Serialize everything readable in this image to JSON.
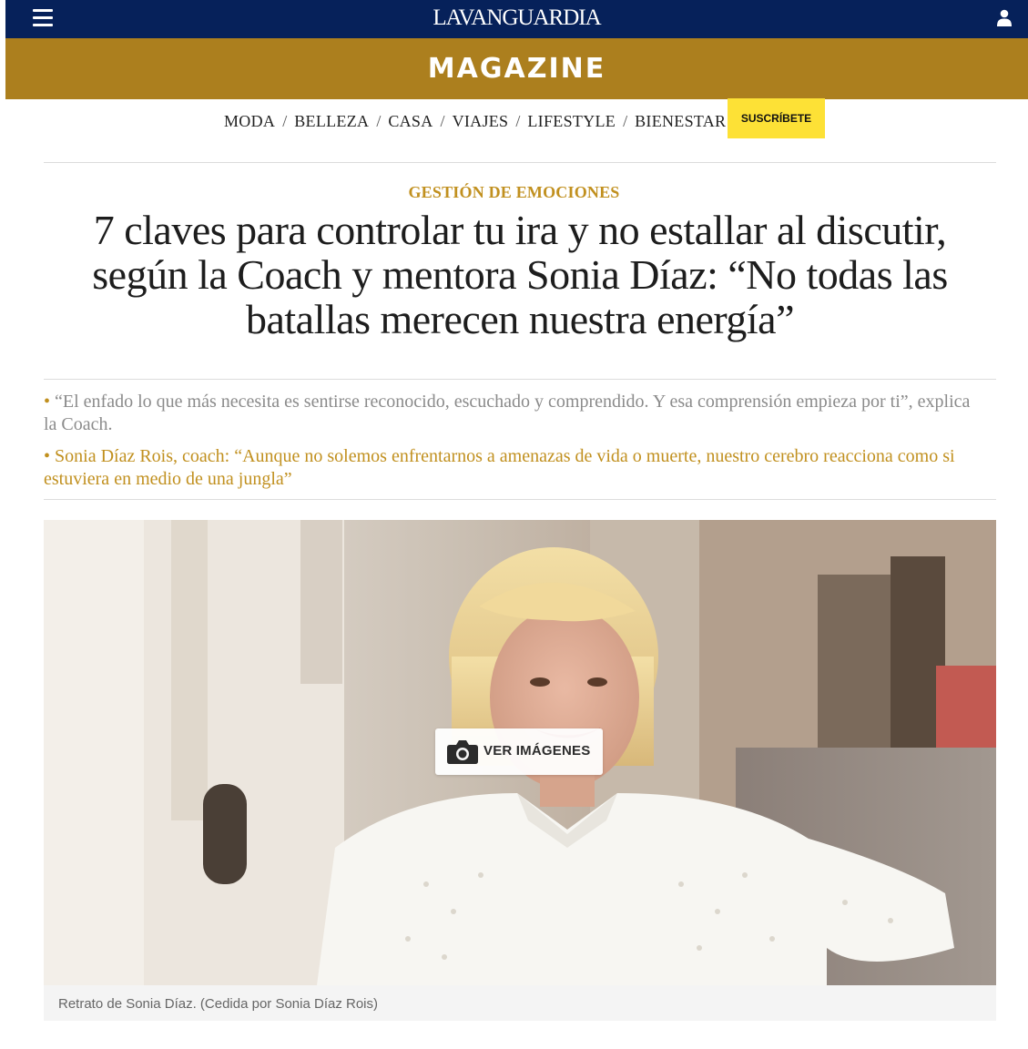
{
  "header": {
    "logo": "LAVANGUARDIA",
    "section_title": "MAGAZINE",
    "colors": {
      "topbar": "#06215a",
      "band": "#ac7f1e",
      "accent": "#c1901f",
      "subscribe": "#fde136"
    },
    "icons": [
      "menu-icon",
      "user-icon"
    ]
  },
  "nav": {
    "items": [
      "MODA",
      "BELLEZA",
      "CASA",
      "VIAJES",
      "LIFESTYLE",
      "BIENESTAR"
    ],
    "separator": "/",
    "subscribe_label": "SUSCRÍBETE"
  },
  "article": {
    "category": "GESTIÓN DE EMOCIONES",
    "headline_lines": [
      "7 claves para controlar tu ira y no estallar al discutir,",
      "según la Coach y mentora Sonia Díaz: “No todas las",
      "batallas merecen nuestra energía”"
    ],
    "bullet": "•",
    "summaries": [
      "“El enfado lo que más necesita es sentirse reconocido, escuchado y comprendido. Y esa comprensión empieza por ti”, explica la Coach.",
      "Sonia Díaz Rois, coach: “Aunque no solemos enfrentarnos a amenazas de vida o muerte, nuestro cerebro reacciona como si estuviera en medio de una jungla”"
    ],
    "image": {
      "button_label": "VER IMÁGENES",
      "button_icon": "camera-icon",
      "caption": "Retrato de Sonia Díaz. (Cedida por Sonia Díaz Rois)"
    }
  }
}
